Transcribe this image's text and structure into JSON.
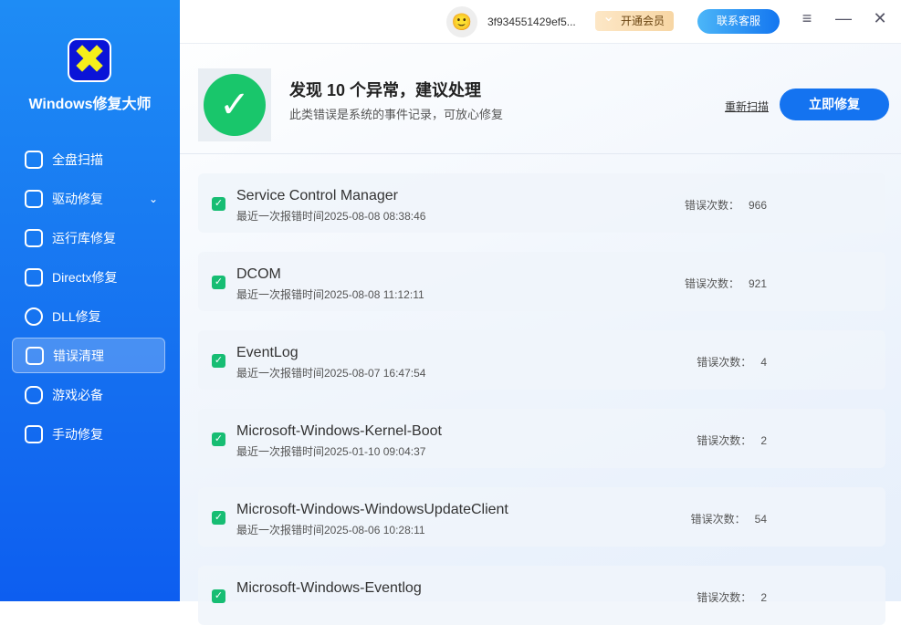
{
  "app": {
    "name": "Windows修复大师"
  },
  "sidebar": {
    "items": [
      {
        "label": "全盘扫描"
      },
      {
        "label": "驱动修复"
      },
      {
        "label": "运行库修复"
      },
      {
        "label": "Directx修复"
      },
      {
        "label": "DLL修复"
      },
      {
        "label": "错误清理"
      },
      {
        "label": "游戏必备"
      },
      {
        "label": "手动修复"
      }
    ]
  },
  "topbar": {
    "user_id": "3f934551429ef5...",
    "vip": "开通会员",
    "service": "联系客服"
  },
  "header": {
    "title": "发现 10 个异常，建议处理",
    "subtitle": "此类错误是系统的事件记录，可放心修复",
    "rescan": "重新扫描",
    "fix": "立即修复"
  },
  "count_label": "错误次数：",
  "rows": [
    {
      "name": "Service Control Manager",
      "time": "最近一次报错时间2025-08-08 08:38:46",
      "count": "966"
    },
    {
      "name": "DCOM",
      "time": "最近一次报错时间2025-08-08 11:12:11",
      "count": "921"
    },
    {
      "name": "EventLog",
      "time": "最近一次报错时间2025-08-07 16:47:54",
      "count": "4"
    },
    {
      "name": "Microsoft-Windows-Kernel-Boot",
      "time": "最近一次报错时间2025-01-10 09:04:37",
      "count": "2"
    },
    {
      "name": "Microsoft-Windows-WindowsUpdateClient",
      "time": "最近一次报错时间2025-08-06 10:28:11",
      "count": "54"
    },
    {
      "name": "Microsoft-Windows-Eventlog",
      "time": "",
      "count": "2"
    }
  ]
}
